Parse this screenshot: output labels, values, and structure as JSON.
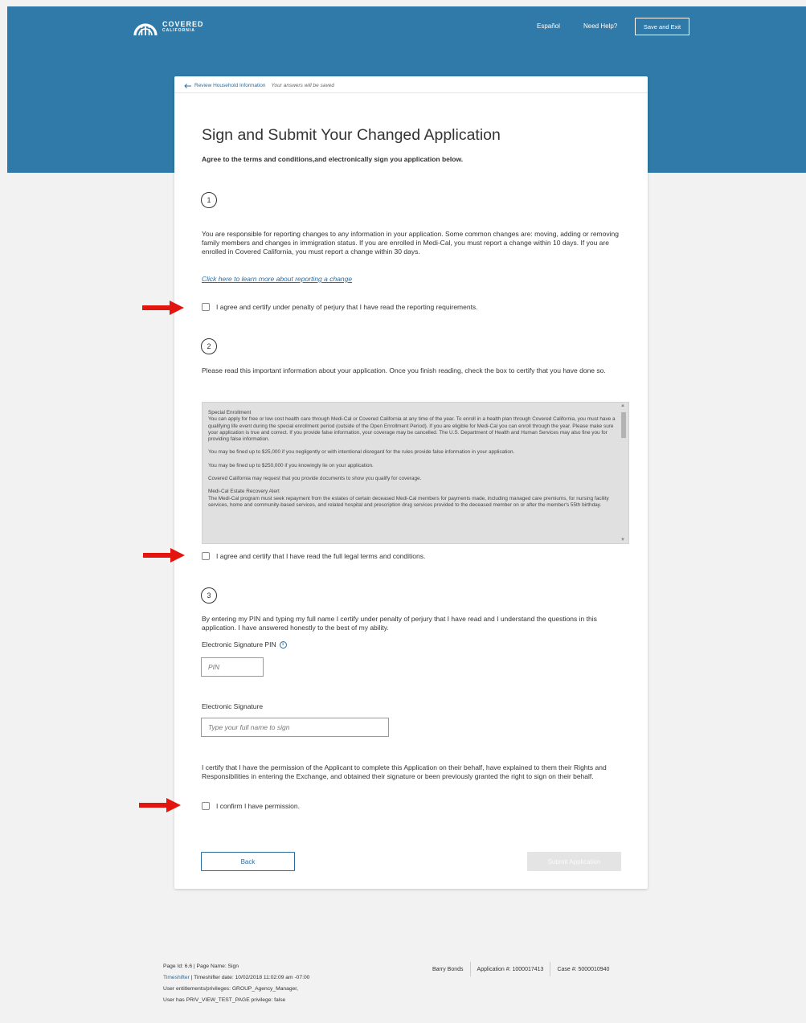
{
  "header": {
    "logo_line1": "COVERED",
    "logo_line2": "CALIFORNIA",
    "espanol": "Español",
    "need_help": "Need Help?",
    "save_exit": "Save and Exit"
  },
  "breadcrumb": {
    "back_label": "Review Household Information",
    "note": "Your answers will be saved"
  },
  "page": {
    "title": "Sign and Submit Your Changed Application",
    "subtitle": "Agree to the terms and conditions,and electronically sign you application below."
  },
  "section1": {
    "number": "1",
    "text": "You are responsible for reporting changes to any information in your application. Some common changes are: moving, adding or removing family members and changes in immigration status. If you are enrolled in Medi-Cal, you must report a change within 10 days. If you are enrolled in Covered California, you must report a change within 30 days.",
    "link": "Click here to learn more about reporting a change",
    "checkbox_label": "I agree and certify under penalty of perjury that I have read the reporting requirements."
  },
  "section2": {
    "number": "2",
    "text": "Please read this important information about your application. Once you finish reading, check the box to certify that you have done so.",
    "legal": {
      "heading1": "Special Enrollment",
      "p1": "You can apply for free or low cost health care through Medi-Cal or Covered California at any time of the year. To enroll in a health plan through Covered California, you must have a qualifying life event during the special enrollment period (outside of the Open Enrollment Period). If you are eligible for Medi-Cal you can enroll through the year. Please make sure your application is true and correct. If you provide false information, your coverage may be cancelled. The U.S. Department of Health and Human Services may also fine you for providing false information.",
      "p2": "You may be fined up to $25,000 if you negligently or with intentional disregard for the rules provide false information in your application.",
      "p3": "You may be fined up to $250,000 if you knowingly lie on your application.",
      "p4": "Covered California may request that you provide documents to show you qualify for coverage.",
      "heading2": "Medi-Cal Estate Recovery Alert",
      "p5": "The Medi-Cal program must seek repayment from the estates of certain deceased Medi-Cal members for payments made, including managed care premiums, for nursing facility services, home and community-based services, and related hospital and prescription drug services provided to the deceased member on or after the member's 55th birthday."
    },
    "checkbox_label": "I agree and certify that I have read the full legal terms and conditions."
  },
  "section3": {
    "number": "3",
    "text": "By entering my PIN and typing my full name I certify under penalty of perjury that I have read and I understand the questions in this application. I have answered honestly to the best of my ability.",
    "pin_label": "Electronic Signature PIN",
    "pin_placeholder": "PIN",
    "signature_label": "Electronic Signature",
    "signature_placeholder": "Type your full name to sign",
    "permission_text": "I certify that I have the permission of the Applicant to complete this Application on their behalf, have explained to them their Rights and Responsibilities in entering the Exchange, and obtained their signature or been previously granted the right to sign on their behalf.",
    "permission_checkbox": "I confirm I have permission."
  },
  "buttons": {
    "back": "Back",
    "submit": "Submit Application"
  },
  "footer": {
    "page_info": "Page Id: 6.6 | Page Name: Sign",
    "timeshifter_link": "Timeshifter",
    "timeshifter_date": "| Timeshifter date: 10/02/2018 11:02:09 am -07:00",
    "entitlements": "User entitlements/privileges: GROUP_Agency_Manager,",
    "priv": "User has PRIV_VIEW_TEST_PAGE privilege: false",
    "user_name": "Barry Bonds",
    "application": "Application #: 1000017413",
    "case": "Case #: 5000010940"
  },
  "colors": {
    "banner": "#2f7aa8",
    "link": "#2b6c9e",
    "annotation_arrow": "#e3160f"
  }
}
